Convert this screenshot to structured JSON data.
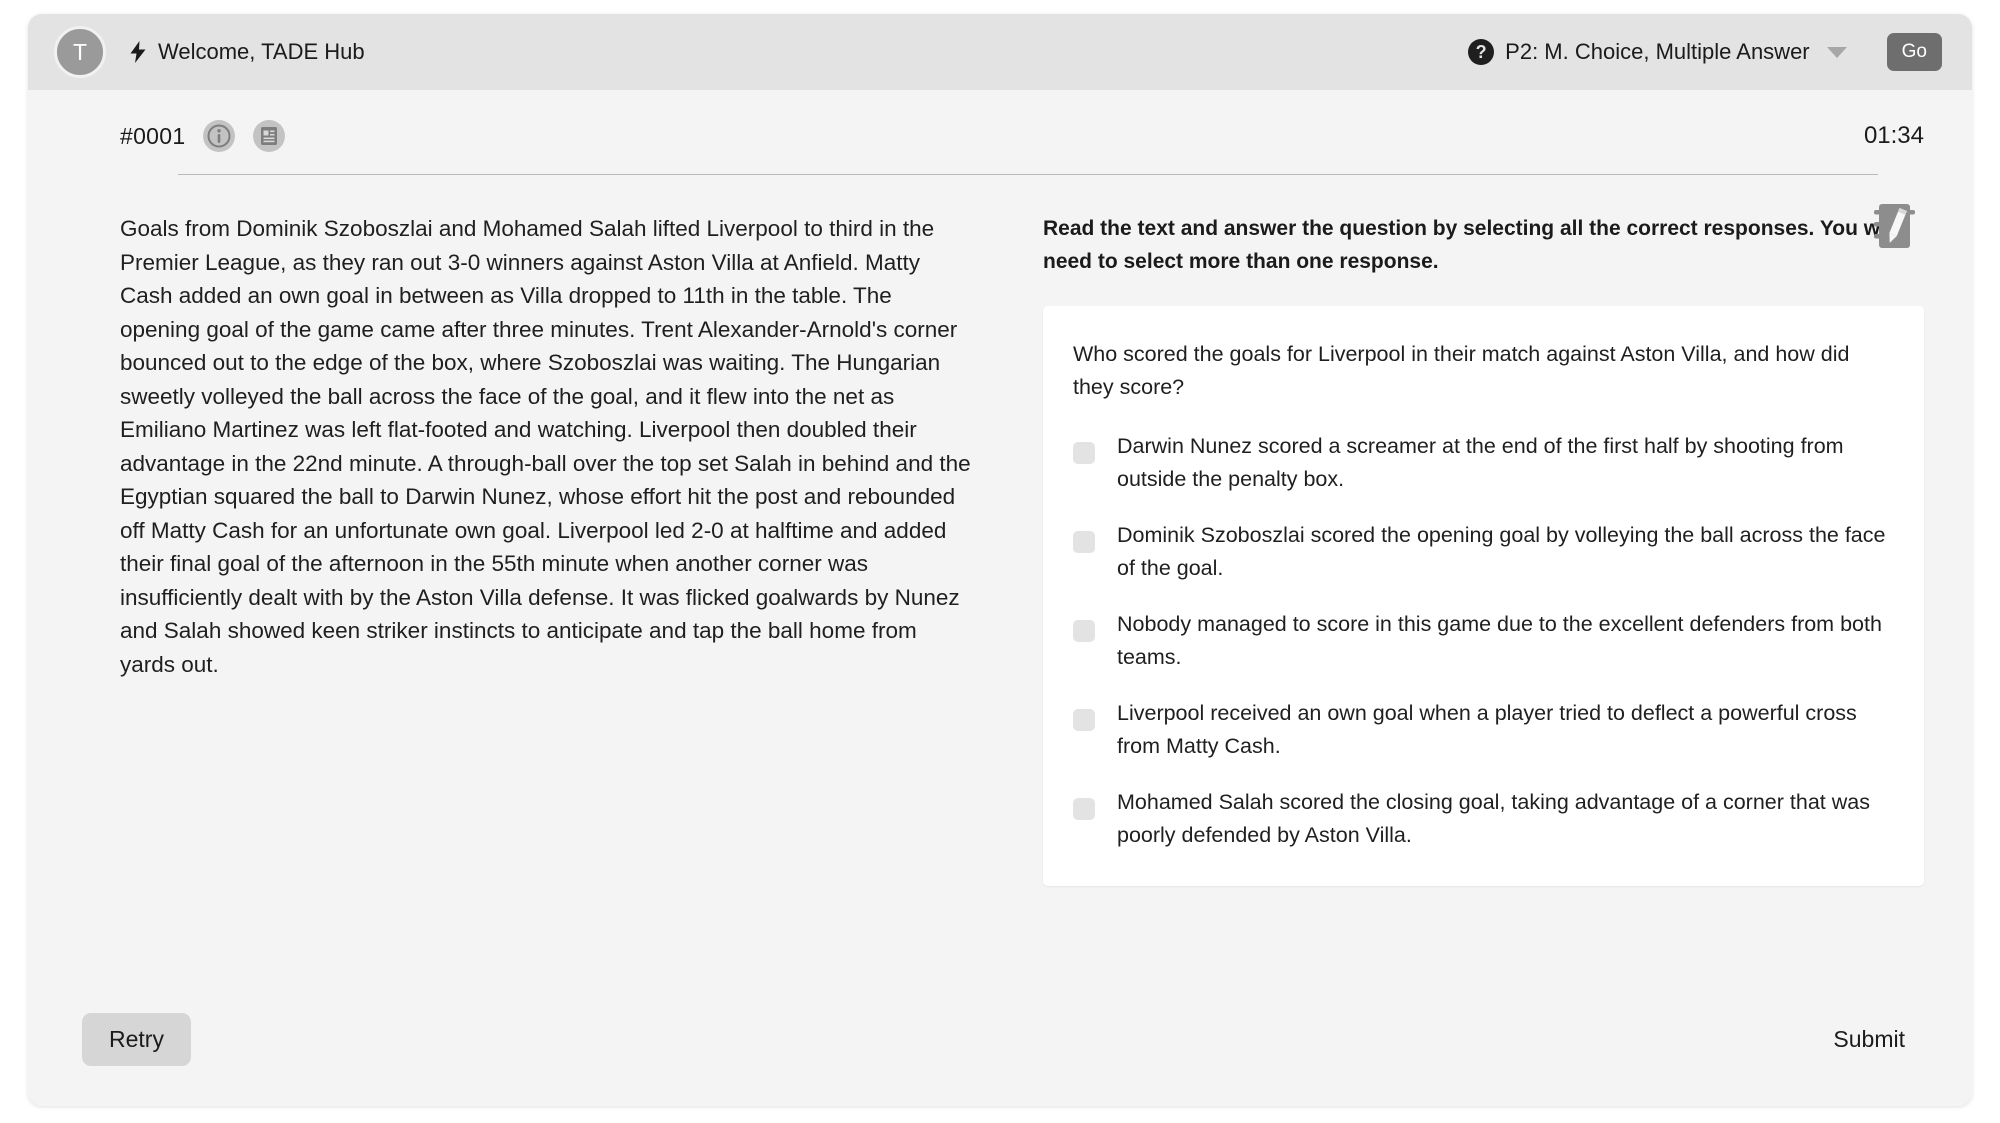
{
  "topbar": {
    "avatar_initial": "T",
    "bolt_icon": "bolt-icon",
    "welcome_text": "Welcome, TADE Hub",
    "help_icon": "question-mark-icon",
    "mode_label": "P2: M. Choice, Multiple Answer",
    "caret_icon": "chevron-down-icon",
    "go_label": "Go",
    "colors": {
      "bar_background": "#e3e3e3",
      "avatar": "#9a9a9a",
      "go_button": "#6e6e6e"
    }
  },
  "meta": {
    "question_number": "#0001",
    "info_icon": "info-icon",
    "transcript_icon": "document-icon",
    "timer": "01:34",
    "notepad_icon": "notepad-pencil-icon"
  },
  "passage": {
    "text": "Goals from Dominik Szoboszlai and Mohamed Salah lifted Liverpool to third in the Premier League, as they ran out 3-0 winners against Aston Villa at Anfield. Matty Cash added an own goal in between as Villa dropped to 11th in the table. The opening goal of the game came after three minutes. Trent Alexander-Arnold's corner bounced out to the edge of the box, where Szoboszlai was waiting. The Hungarian sweetly volleyed the ball across the face of the goal, and it flew into the net as Emiliano Martinez was left flat-footed and watching. Liverpool then doubled their advantage in the 22nd minute. A through-ball over the top set Salah in behind and the Egyptian squared the ball to Darwin Nunez, whose effort hit the post and rebounded off Matty Cash for an unfortunate own goal. Liverpool led 2-0 at halftime and added their final goal of the afternoon in the 55th minute when another corner was insufficiently dealt with by the Aston Villa defense. It was flicked goalwards by Nunez and Salah showed keen striker instincts to anticipate and tap the ball home from yards out."
  },
  "question": {
    "instruction": "Read the text and answer the question by selecting all the correct responses. You will need to select more than one response.",
    "prompt": "Who scored the goals for Liverpool in their match against Aston Villa, and how did they score?",
    "options": [
      {
        "label": "Darwin Nunez scored a screamer at the end of the first half by shooting from outside the penalty box.",
        "checked": false
      },
      {
        "label": "Dominik Szoboszlai scored the opening goal by volleying the ball across the face of the goal.",
        "checked": false
      },
      {
        "label": "Nobody managed to score in this game due to the excellent defenders from both teams.",
        "checked": false
      },
      {
        "label": "Liverpool received an own goal when a player tried to deflect a powerful cross from Matty Cash.",
        "checked": false
      },
      {
        "label": "Mohamed Salah scored the closing goal, taking advantage of a corner that was poorly defended by Aston Villa.",
        "checked": false
      }
    ]
  },
  "footer": {
    "retry_label": "Retry",
    "submit_label": "Submit"
  }
}
